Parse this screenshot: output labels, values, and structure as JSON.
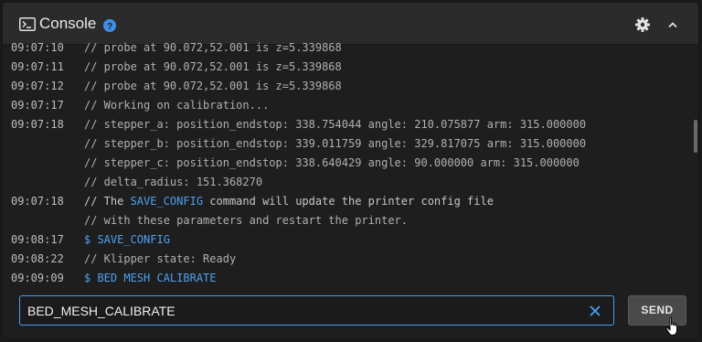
{
  "header": {
    "title": "Console",
    "icons": [
      "console-icon",
      "help-icon",
      "gear-icon",
      "chevron-up-icon"
    ]
  },
  "log": [
    {
      "ts": "09:07:10",
      "text": "// probe at 90.072,52.001 is z=5.339868",
      "kind": "comment"
    },
    {
      "ts": "09:07:11",
      "text": "// probe at 90.072,52.001 is z=5.339868",
      "kind": "comment"
    },
    {
      "ts": "09:07:12",
      "text": "// probe at 90.072,52.001 is z=5.339868",
      "kind": "comment"
    },
    {
      "ts": "09:07:17",
      "text": "// Working on calibration...",
      "kind": "comment"
    },
    {
      "ts": "09:07:18",
      "text": "// stepper_a: position_endstop: 338.754044 angle: 210.075877 arm: 315.000000",
      "kind": "comment"
    },
    {
      "ts": "",
      "text": "// stepper_b: position_endstop: 339.011759 angle: 329.817075 arm: 315.000000",
      "kind": "comment"
    },
    {
      "ts": "",
      "text": "// stepper_c: position_endstop: 338.640429 angle: 90.000000 arm: 315.000000",
      "kind": "comment"
    },
    {
      "ts": "",
      "text": "// delta_radius: 151.368270",
      "kind": "comment"
    },
    {
      "ts": "09:07:18",
      "text_before": "// The ",
      "highlight": "SAVE_CONFIG",
      "text_after": " command will update the printer config file",
      "kind": "comment-highlight"
    },
    {
      "ts": "",
      "text": "// with these parameters and restart the printer.",
      "kind": "comment"
    },
    {
      "ts": "09:08:17",
      "text": "$ SAVE_CONFIG",
      "kind": "command"
    },
    {
      "ts": "09:08:22",
      "text": "// Klipper state: Ready",
      "kind": "comment"
    },
    {
      "ts": "09:09:09",
      "text": "$ BED MESH CALIBRATE",
      "kind": "command"
    }
  ],
  "input": {
    "value": "BED_MESH_CALIBRATE"
  },
  "send_label": "SEND",
  "colors": {
    "accent": "#4ea0f0",
    "input_border": "#4c9ef7",
    "help_icon": "#3f8ee8"
  }
}
